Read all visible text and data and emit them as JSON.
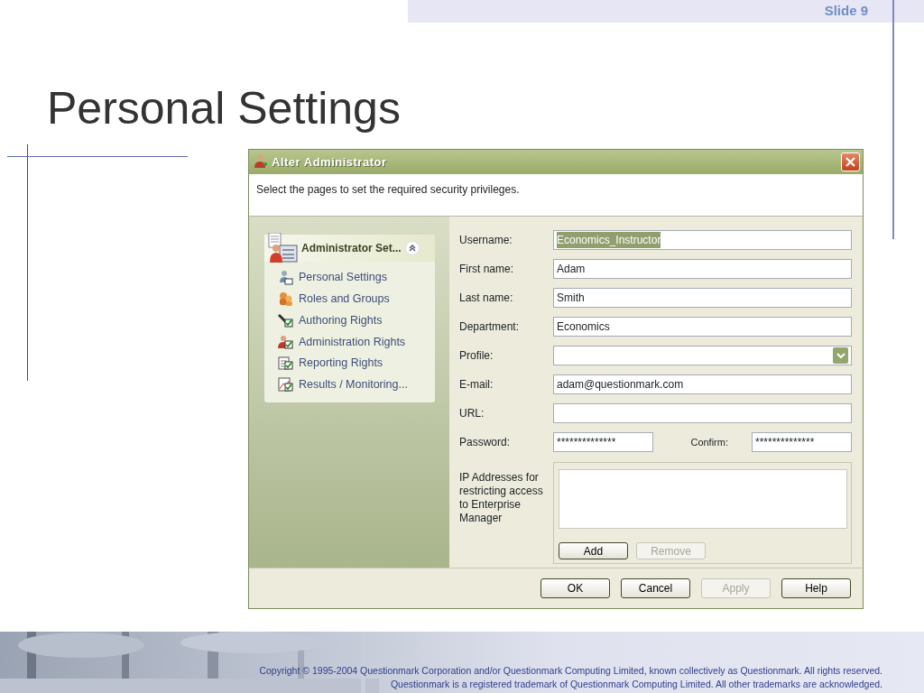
{
  "slide": {
    "number_label": "Slide 9",
    "title": "Personal Settings"
  },
  "dialog": {
    "title": "Alter Administrator",
    "instruction": "Select the pages to set the required security privileges.",
    "nav_panel": {
      "header": "Administrator Set...",
      "expanded": true,
      "items": [
        {
          "label": "Personal Settings"
        },
        {
          "label": "Roles and Groups"
        },
        {
          "label": "Authoring Rights"
        },
        {
          "label": "Administration Rights"
        },
        {
          "label": "Reporting Rights"
        },
        {
          "label": "Results / Monitoring..."
        }
      ]
    },
    "fields": [
      {
        "kind": "text",
        "label": "Username:",
        "value": "Economics_Instructor",
        "highlighted": true
      },
      {
        "kind": "text",
        "label": "First name:",
        "value": "Adam",
        "highlighted": false
      },
      {
        "kind": "text",
        "label": "Last name:",
        "value": "Smith",
        "highlighted": false
      },
      {
        "kind": "text",
        "label": "Department:",
        "value": "Economics",
        "highlighted": false
      },
      {
        "kind": "select",
        "label": "Profile:"
      },
      {
        "kind": "text",
        "label": "E-mail:",
        "value": "adam@questionmark.com",
        "highlighted": false
      },
      {
        "kind": "text",
        "label": "URL:"
      },
      {
        "kind": "password",
        "label": "Password:",
        "value": "**************",
        "confirm_label": "Confirm:",
        "confirm_value": "**************"
      }
    ],
    "ip_addresses": {
      "label": "IP Addresses for restricting access to Enterprise Manager",
      "buttons": [
        {
          "label": "Add",
          "disabled": false
        },
        {
          "label": "Remove",
          "disabled": true
        }
      ]
    },
    "buttons": [
      {
        "label": "OK",
        "disabled": false
      },
      {
        "label": "Cancel",
        "disabled": false
      },
      {
        "label": "Apply",
        "disabled": true
      },
      {
        "label": "Help",
        "disabled": false
      }
    ]
  },
  "footer": {
    "lines": [
      "Copyright © 1995-2004 Questionmark Corporation and/or Questionmark Computing Limited, known collectively as Questionmark. All rights reserved.",
      "Questionmark is a registered trademark of Questionmark Computing Limited. All other trademarks are acknowledged."
    ]
  }
}
